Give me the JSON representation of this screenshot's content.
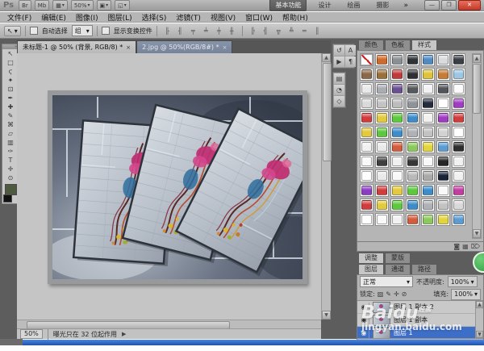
{
  "app_bar": {
    "logo": "Ps",
    "icons": [
      {
        "name": "bridge-launch-icon",
        "glyph": "Br",
        "caret": false
      },
      {
        "name": "mini-bridge-icon",
        "glyph": "Mb",
        "caret": false
      },
      {
        "name": "view-extras-icon",
        "glyph": "▦",
        "caret": true
      },
      {
        "name": "zoom-level-dropdown",
        "glyph": "50%",
        "caret": true
      },
      {
        "name": "arrange-documents-icon",
        "glyph": "▣",
        "caret": true
      },
      {
        "name": "screen-mode-icon",
        "glyph": "◱",
        "caret": true
      }
    ],
    "workspaces": [
      "基本功能",
      "设计",
      "绘画",
      "摄影"
    ],
    "workspace_overflow": "»",
    "window_buttons": {
      "minimize": "—",
      "restore": "❐",
      "close": "✕"
    }
  },
  "menu_bar": {
    "items": [
      "文件(F)",
      "编辑(E)",
      "图像(I)",
      "图层(L)",
      "选择(S)",
      "滤镜(T)",
      "视图(V)",
      "窗口(W)",
      "帮助(H)"
    ]
  },
  "options_bar": {
    "tool_glyph": "↖",
    "tool_caret": "▾",
    "auto_select_label": "自动选择",
    "auto_select_value": "组",
    "auto_select_caret": "▾",
    "show_transform_label": "显示变换控件",
    "align_icons": [
      "╟",
      "╢",
      "╤",
      "╧",
      "╪",
      "╫"
    ],
    "distribute_icons": [
      "╠",
      "╣",
      "╦",
      "╩",
      "═",
      "║"
    ]
  },
  "toolbar": {
    "header_glyph": "»",
    "tools": [
      {
        "name": "move-tool",
        "glyph": "↖"
      },
      {
        "name": "marquee-tool",
        "glyph": "□"
      },
      {
        "name": "lasso-tool",
        "glyph": "ϛ"
      },
      {
        "name": "quick-select-tool",
        "glyph": "✦"
      },
      {
        "name": "crop-tool",
        "glyph": "⊡"
      },
      {
        "name": "eyedropper-tool",
        "glyph": "✒"
      },
      {
        "name": "healing-brush-tool",
        "glyph": "✚"
      },
      {
        "name": "brush-tool",
        "glyph": "✎"
      },
      {
        "name": "clone-stamp-tool",
        "glyph": "⌘"
      },
      {
        "name": "eraser-tool",
        "glyph": "▱"
      },
      {
        "name": "gradient-tool",
        "glyph": "▥"
      },
      {
        "name": "pen-tool",
        "glyph": "✑"
      },
      {
        "name": "type-tool",
        "glyph": "T"
      },
      {
        "name": "hand-tool",
        "glyph": "✛"
      },
      {
        "name": "zoom-tool",
        "glyph": "⊙"
      }
    ],
    "foreground_color": "#4e5a40",
    "background_color": "#111111"
  },
  "document": {
    "tabs": [
      {
        "label": "未标题-1 @ 50% (背景, RGB/8) *",
        "close": "×",
        "active": true
      },
      {
        "label": "2.jpg @ 50%(RGB/8#) *",
        "close": "×",
        "active": false
      }
    ],
    "status": {
      "zoom": "50%",
      "hint": "曝光只在 32 位起作用",
      "play": "▶"
    }
  },
  "dock": {
    "top_icons": [
      {
        "name": "history-panel-icon",
        "glyph": "↺"
      },
      {
        "name": "character-panel-icon",
        "glyph": "A"
      },
      {
        "name": "actions-panel-icon",
        "glyph": "▶"
      },
      {
        "name": "paragraph-panel-icon",
        "glyph": "¶"
      }
    ],
    "bottom_icons": [
      {
        "name": "info-panel-icon",
        "glyph": "▤"
      },
      {
        "name": "histogram-panel-icon",
        "glyph": "◔"
      },
      {
        "name": "navigator-panel-icon",
        "glyph": "◇"
      }
    ]
  },
  "panels": {
    "top_tabs": [
      {
        "label": "颜色",
        "active": false
      },
      {
        "label": "色板",
        "active": false
      },
      {
        "label": "样式",
        "active": true
      }
    ],
    "styles_footer_icons": [
      "◙",
      "▦",
      "⌦"
    ],
    "styles_rows": [
      [
        "none",
        "#d06a2a",
        "#8a8f94",
        "#2e3338",
        "#4f8ac2",
        "#d9dadb",
        "#3a3f45"
      ],
      [
        "#8a6848",
        "#9a6f3a",
        "#c03a3a",
        "#2f2f33",
        "#ddc23a",
        "#c77c35",
        "#9cc6e2"
      ],
      [
        "#e9e9e9",
        "#a9adb2",
        "#6a4f92",
        "#55585c",
        "#f2f2f2",
        "#515459",
        "#fbfbfb"
      ],
      [
        "#d9d9d9",
        "#c3c3c3",
        "#bcbcbc",
        "#8f9397",
        "#232b3d",
        "#ffffff",
        "#a13cc2"
      ],
      [
        "#d23c3c",
        "#e2ca3c",
        "#5cc93c",
        "#3c8cc9",
        "#f1f1f1",
        "#a13cc2",
        "#d23c3c"
      ],
      [
        "#e2ca3c",
        "#5cc93c",
        "#3c8cc9",
        "#aeb2b6",
        "#c2c2c2",
        "#d2d2d2",
        "#ffffff"
      ],
      [
        "#f1f1f1",
        "#e9e9e9",
        "#d25c3c",
        "#8cc95c",
        "#e2d53c",
        "#5c9cd2",
        "#2e2e2e"
      ],
      [
        "#f9f9f9",
        "#3f3f3f",
        "#f1f1f1",
        "#373737",
        "#f9f9f9",
        "#262626",
        "#f1f1f1"
      ],
      [
        "#ffffff",
        "#e9e9e9",
        "#f9f9f9",
        "#b9b9b9",
        "#a9a9a9",
        "#1a2438",
        "#f1f1f1"
      ],
      [
        "#8c3cc2",
        "#d23c3c",
        "#e2ca3c",
        "#5cc93c",
        "#3c8cc9",
        "#f9f9f9",
        "#c23ca1"
      ],
      [
        "#d23c3c",
        "#e2ca3c",
        "#5cc93c",
        "#3c8cc9",
        "#aeb2b6",
        "#c2c2c2",
        "#d9d9d9"
      ],
      [
        "#ffffff",
        "#f9f9f9",
        "#f1f1f1",
        "#d25c3c",
        "#8cc95c",
        "#e2d53c",
        "#5c9cd2"
      ]
    ],
    "mid_tabs": [
      {
        "label": "调整",
        "active": true
      },
      {
        "label": "蒙版",
        "active": false
      }
    ],
    "layers_tabs": [
      {
        "label": "图层",
        "active": true
      },
      {
        "label": "通道",
        "active": false
      },
      {
        "label": "路径",
        "active": false
      }
    ],
    "blend_mode": "正常",
    "blend_caret": "▾",
    "opacity_label": "不透明度:",
    "opacity_value": "100%",
    "lock_label": "锁定:",
    "lock_icons": [
      "▨",
      "✎",
      "✛",
      "⊘"
    ],
    "fill_label": "填充:",
    "fill_value": "100%",
    "eye_glyph": "◉",
    "layers": [
      {
        "name": "图层 1 副本 2",
        "selected": false
      },
      {
        "name": "图层 1 副本",
        "selected": false
      },
      {
        "name": "图层 1",
        "selected": true
      }
    ],
    "bottom_icons": [
      {
        "name": "link-layers-icon",
        "glyph": "∞"
      },
      {
        "name": "layer-style-icon",
        "glyph": "fx"
      },
      {
        "name": "layer-mask-icon",
        "glyph": "◙"
      },
      {
        "name": "adjustment-layer-icon",
        "glyph": "◐"
      },
      {
        "name": "layer-group-icon",
        "glyph": "▭"
      },
      {
        "name": "new-layer-icon",
        "glyph": "▦"
      },
      {
        "name": "delete-layer-icon",
        "glyph": "⌦"
      }
    ]
  },
  "watermark": {
    "brand": "Baidu",
    "brand_sub": "经验",
    "url": "jingyan.baidu.com"
  },
  "colors": {
    "selection_blue": "#3d6fc9",
    "workspace_gray": "#5d5d5d",
    "close_red": "#c23a2a",
    "badge_green": "#2f9e3e"
  }
}
